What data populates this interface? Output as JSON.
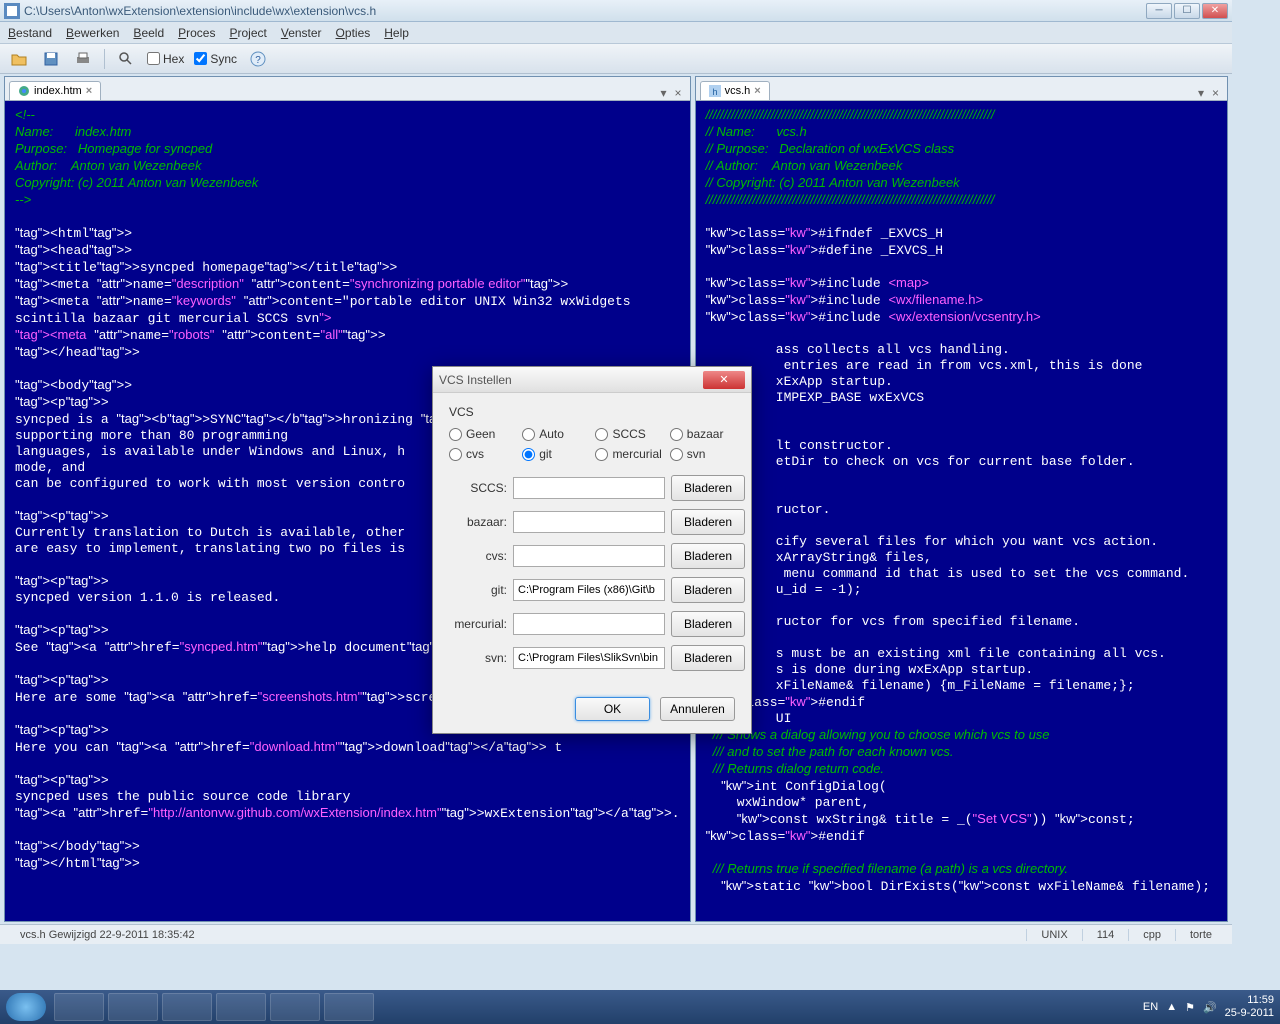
{
  "window": {
    "title": "C:\\Users\\Anton\\wxExtension\\extension\\include\\wx\\extension\\vcs.h"
  },
  "menu": {
    "items": [
      "Bestand",
      "Bewerken",
      "Beeld",
      "Proces",
      "Project",
      "Venster",
      "Opties",
      "Help"
    ]
  },
  "toolbar": {
    "hex": "Hex",
    "sync": "Sync"
  },
  "left": {
    "tab": "index.htm",
    "code": "<!--\nName:      index.htm\nPurpose:   Homepage for syncped\nAuthor:    Anton van Wezenbeek\nCopyright: (c) 2011 Anton van Wezenbeek\n-->\n\n<html>\n<head>\n<title>syncped homepage</title>\n<meta name=\"description\" content=\"synchronizing portable editor\">\n<meta name=\"keywords\" content=\"portable editor UNIX Win32 wxWidgets\nscintilla bazaar git mercurial SCCS svn\">\n<meta name=\"robots\" content=\"all\">\n</head>\n\n<body>\n<p>\nsyncped is a <b>SYNC</b>hronizing <b>P</b>ortable\nsupporting more than 80 programming\nlanguages, is available under Windows and Linux, h\nmode, and\ncan be configured to work with most version contro\n\n<p>\nCurrently translation to Dutch is available, other\nare easy to implement, translating two po files is\n\n<p>\nsyncped version 1.1.0 is released.\n\n<p>\nSee <a href=\"syncped.htm\">help document</a>.\n\n<p>\nHere are some <a href=\"screenshots.htm\">screenshot\n\n<p>\nHere you can <a href=\"download.htm\">download</a> t\n\n<p>\nsyncped uses the public source code library\n<a href=\"http://antonvw.github.com/wxExtension/index.htm\">wxExtension</a>.\n\n</body>\n</html>"
  },
  "right": {
    "tab": "vcs.h",
    "code": "////////////////////////////////////////////////////////////////////////////////\n// Name:      vcs.h\n// Purpose:   Declaration of wxExVCS class\n// Author:    Anton van Wezenbeek\n// Copyright: (c) 2011 Anton van Wezenbeek\n////////////////////////////////////////////////////////////////////////////////\n\n#ifndef _EXVCS_H\n#define _EXVCS_H\n\n#include <map>\n#include <wx/filename.h>\n#include <wx/extension/vcsentry.h>\n\n         ass collects all vcs handling.\n          entries are read in from vcs.xml, this is done\n         xExApp startup.\n         IMPEXP_BASE wxExVCS\n\n\n         lt constructor.\n         etDir to check on vcs for current base folder.\n\n\n         ructor.\n\n         cify several files for which you want vcs action.\n         xArrayString& files,\n          menu command id that is used to set the vcs command.\n         u_id = -1);\n\n         ructor for vcs from specified filename.\n\n         s must be an existing xml file containing all vcs.\n         s is done during wxExApp startup.\n         xFileName& filename) {m_FileName = filename;};\n#endif\n         UI\n  /// Shows a dialog allowing you to choose which vcs to use\n  /// and to set the path for each known vcs.\n  /// Returns dialog return code.\n  int ConfigDialog(\n    wxWindow* parent,\n    const wxString& title = _(\"Set VCS\")) const;\n#endif\n\n  /// Returns true if specified filename (a path) is a vcs directory.\n  static bool DirExists(const wxFileName& filename);"
  },
  "dialog": {
    "title": "VCS Instellen",
    "group": "VCS",
    "radios": [
      "Geen",
      "Auto",
      "SCCS",
      "bazaar",
      "cvs",
      "git",
      "mercurial",
      "svn"
    ],
    "selected": "git",
    "fields": [
      {
        "label": "SCCS:",
        "value": ""
      },
      {
        "label": "bazaar:",
        "value": ""
      },
      {
        "label": "cvs:",
        "value": ""
      },
      {
        "label": "git:",
        "value": "C:\\Program Files (x86)\\Git\\b"
      },
      {
        "label": "mercurial:",
        "value": ""
      },
      {
        "label": "svn:",
        "value": "C:\\Program Files\\SlikSvn\\bin"
      }
    ],
    "browse": "Bladeren",
    "ok": "OK",
    "cancel": "Annuleren"
  },
  "status": {
    "left": "vcs.h Gewijzigd 22-9-2011 18:35:42",
    "segs": [
      "UNIX",
      "114",
      "cpp",
      "torte"
    ]
  },
  "tray": {
    "lang": "EN",
    "time": "11:59",
    "date": "25-9-2011"
  }
}
